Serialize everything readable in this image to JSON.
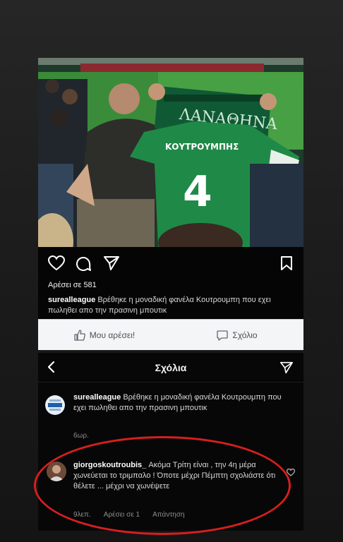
{
  "post": {
    "likes": "Αρέσει σε 581",
    "username": "surealleague",
    "caption": "Βρέθηκε η μοναδική φανέλα Κουτρουμπη που εχει πωληθει απο την πρασινη μπουτικ",
    "jersey_name": "ΚΟΥΤΡΟΥΜΠΗΣ",
    "jersey_number": "4"
  },
  "fb_bar": {
    "like_label": "Μου αρέσει!",
    "comment_label": "Σχόλιο"
  },
  "comments_screen": {
    "title": "Σχόλια",
    "original_post": {
      "username": "surealleague",
      "text": "Βρέθηκε η μοναδική φανέλα Κουτρουμπη που εχει πωληθει απο την πρασινη μπουτικ",
      "time": "6ωρ."
    },
    "reply": {
      "username": "giorgoskoutroubis_",
      "text": "Ακόμα Τρίτη είναι , την 4η μέρα χωνεύεται το τριμπαλο ! Όποτε μέχρι Πέμπτη σχολιάστε ότι θέλετε ... μέχρι να χωνέψετε",
      "time": "9λεπ.",
      "likes": "Αρέσει σε 1",
      "reply_label": "Απάντηση"
    }
  },
  "colors": {
    "highlight_oval": "#d81e1e",
    "jersey_green": "#1f8a47",
    "background": "#1b1b1b"
  }
}
